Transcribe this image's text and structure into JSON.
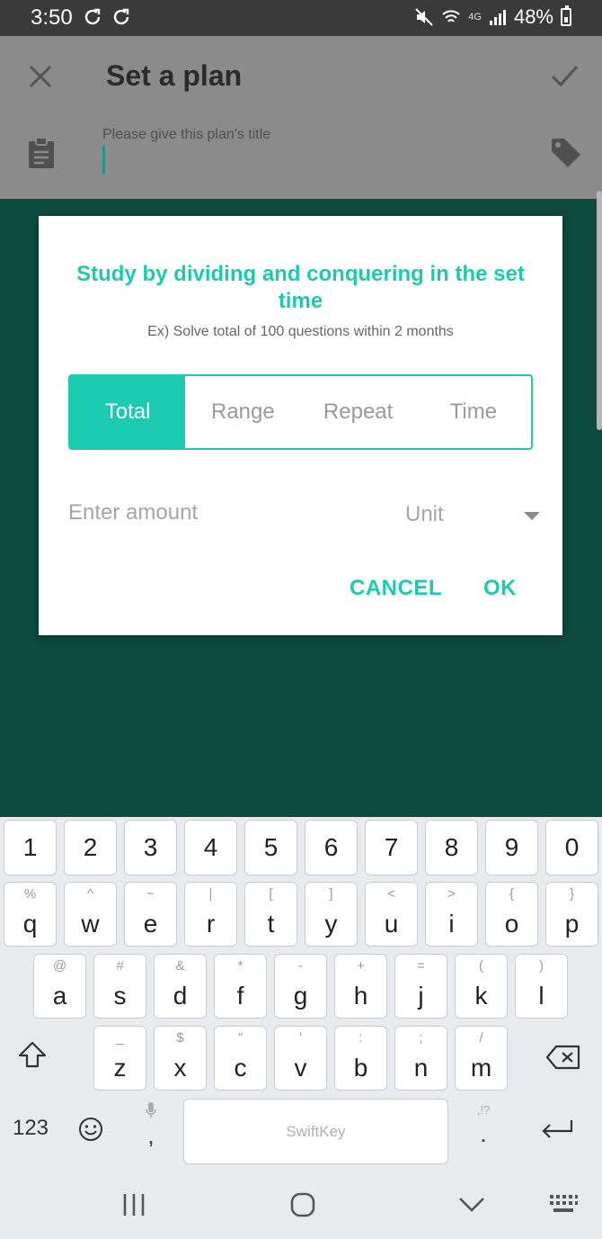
{
  "status_bar": {
    "time": "3:50",
    "network": "4G",
    "battery": "48%"
  },
  "app_bar": {
    "title": "Set a plan",
    "title_placeholder": "Please give this plan's title"
  },
  "dialog": {
    "heading": "Study by dividing and conquering in the set time",
    "subtitle": "Ex) Solve total of 100 questions within 2 months",
    "tabs": [
      {
        "label": "Total",
        "selected": true
      },
      {
        "label": "Range",
        "selected": false
      },
      {
        "label": "Repeat",
        "selected": false
      },
      {
        "label": "Time",
        "selected": false
      }
    ],
    "amount_placeholder": "Enter amount",
    "unit_label": "Unit",
    "cancel_label": "CANCEL",
    "ok_label": "OK"
  },
  "keyboard": {
    "number_row": [
      "1",
      "2",
      "3",
      "4",
      "5",
      "6",
      "7",
      "8",
      "9",
      "0"
    ],
    "row1": [
      {
        "k": "q",
        "a": "%"
      },
      {
        "k": "w",
        "a": "^"
      },
      {
        "k": "e",
        "a": "~"
      },
      {
        "k": "r",
        "a": "|"
      },
      {
        "k": "t",
        "a": "["
      },
      {
        "k": "y",
        "a": "]"
      },
      {
        "k": "u",
        "a": "<"
      },
      {
        "k": "i",
        "a": ">"
      },
      {
        "k": "o",
        "a": "{"
      },
      {
        "k": "p",
        "a": "}"
      }
    ],
    "row2": [
      {
        "k": "a",
        "a": "@"
      },
      {
        "k": "s",
        "a": "#"
      },
      {
        "k": "d",
        "a": "&"
      },
      {
        "k": "f",
        "a": "*"
      },
      {
        "k": "g",
        "a": "-"
      },
      {
        "k": "h",
        "a": "+"
      },
      {
        "k": "j",
        "a": "="
      },
      {
        "k": "k",
        "a": "("
      },
      {
        "k": "l",
        "a": ")"
      }
    ],
    "row3": [
      {
        "k": "z",
        "a": "_"
      },
      {
        "k": "x",
        "a": "$"
      },
      {
        "k": "c",
        "a": "\""
      },
      {
        "k": "v",
        "a": "'"
      },
      {
        "k": "b",
        "a": ":"
      },
      {
        "k": "n",
        "a": ";"
      },
      {
        "k": "m",
        "a": "/"
      }
    ],
    "mode_key": "123",
    "comma": ",",
    "space_label": "SwiftKey",
    "period": ".",
    "period_alt": ",!?"
  },
  "colors": {
    "accent": "#1ccab0",
    "backdrop": "#0e4a3f",
    "app_bar": "#8b8b8b"
  }
}
